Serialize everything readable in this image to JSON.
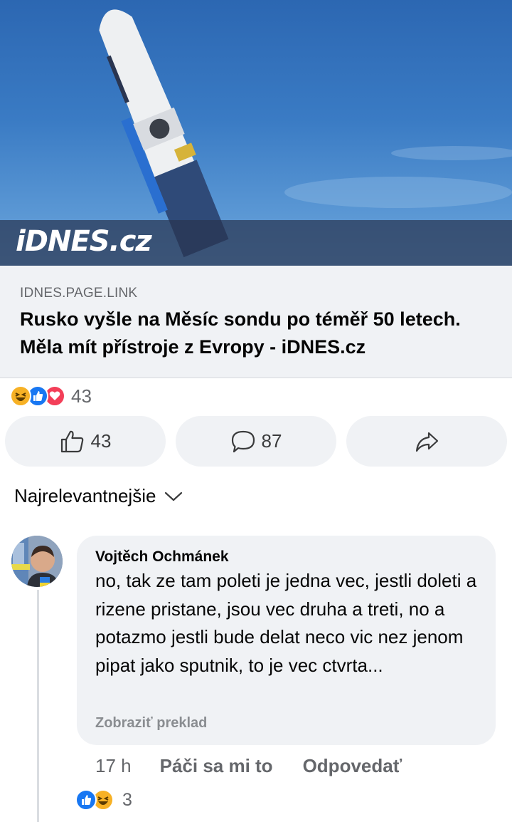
{
  "preview": {
    "watermark": "iDNES.cz"
  },
  "link": {
    "domain": "IDNES.PAGE.LINK",
    "title": "Rusko vyšle na Měsíc sondu po téměř 50 letech. Měla mít přístroje z Evropy - iDNES.cz"
  },
  "reactions": {
    "icons": [
      "haha-icon",
      "like-icon",
      "love-icon"
    ],
    "count": "43"
  },
  "actions": {
    "like_count": "43",
    "comment_count": "87"
  },
  "sort": {
    "label": "Najrelevantnejšie"
  },
  "comment": {
    "author": "Vojtěch Ochmánek",
    "text": "no, tak ze tam poleti je jedna vec, jestli doleti a rizene pristane, jsou vec druha a treti, no a potazmo jestli bude delat neco vic nez jenom pipat jako sputnik, to je vec ctvrta...",
    "translate": "Zobraziť preklad",
    "time": "17 h",
    "like_label": "Páči sa mi to",
    "reply_label": "Odpovedať",
    "reaction_icons": [
      "like-icon",
      "haha-icon"
    ],
    "reaction_count": "3"
  },
  "colors": {
    "like_blue": "#1877f2",
    "love_red": "#f33e58",
    "haha_yellow": "#f7b125",
    "secondary_text": "#65676b",
    "bubble_bg": "#f0f2f5"
  }
}
